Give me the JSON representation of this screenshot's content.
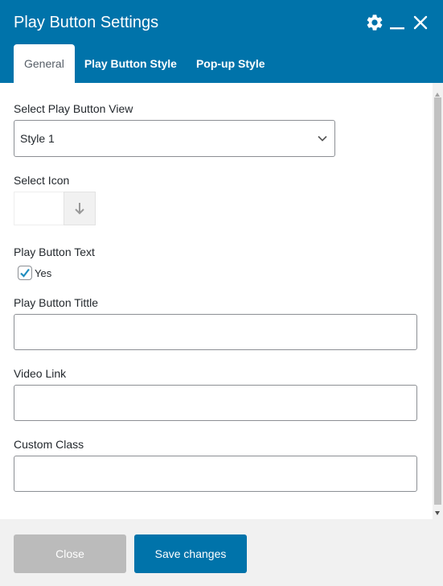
{
  "dialog": {
    "title": "Play Button Settings",
    "header_icons": [
      "gear-icon",
      "minimize-icon",
      "close-icon"
    ]
  },
  "tabs": [
    {
      "label": "General",
      "active": true
    },
    {
      "label": "Play Button Style",
      "active": false
    },
    {
      "label": "Pop-up Style",
      "active": false
    }
  ],
  "form": {
    "view": {
      "label": "Select Play Button View",
      "selected": "Style 1"
    },
    "icon": {
      "label": "Select Icon",
      "picker_icon": "arrow-down-icon"
    },
    "text": {
      "label": "Play Button Text",
      "checkbox_label": "Yes",
      "checked": true
    },
    "title_field": {
      "label": "Play Button Tittle",
      "value": ""
    },
    "video_link": {
      "label": "Video Link",
      "value": ""
    },
    "custom_class": {
      "label": "Custom Class",
      "value": ""
    }
  },
  "footer": {
    "close_label": "Close",
    "save_label": "Save changes"
  },
  "colors": {
    "header_bg": "#0073aa",
    "primary_button": "#0073aa",
    "disabled_button": "#bbbbbb",
    "footer_bg": "#f1f1f1"
  }
}
